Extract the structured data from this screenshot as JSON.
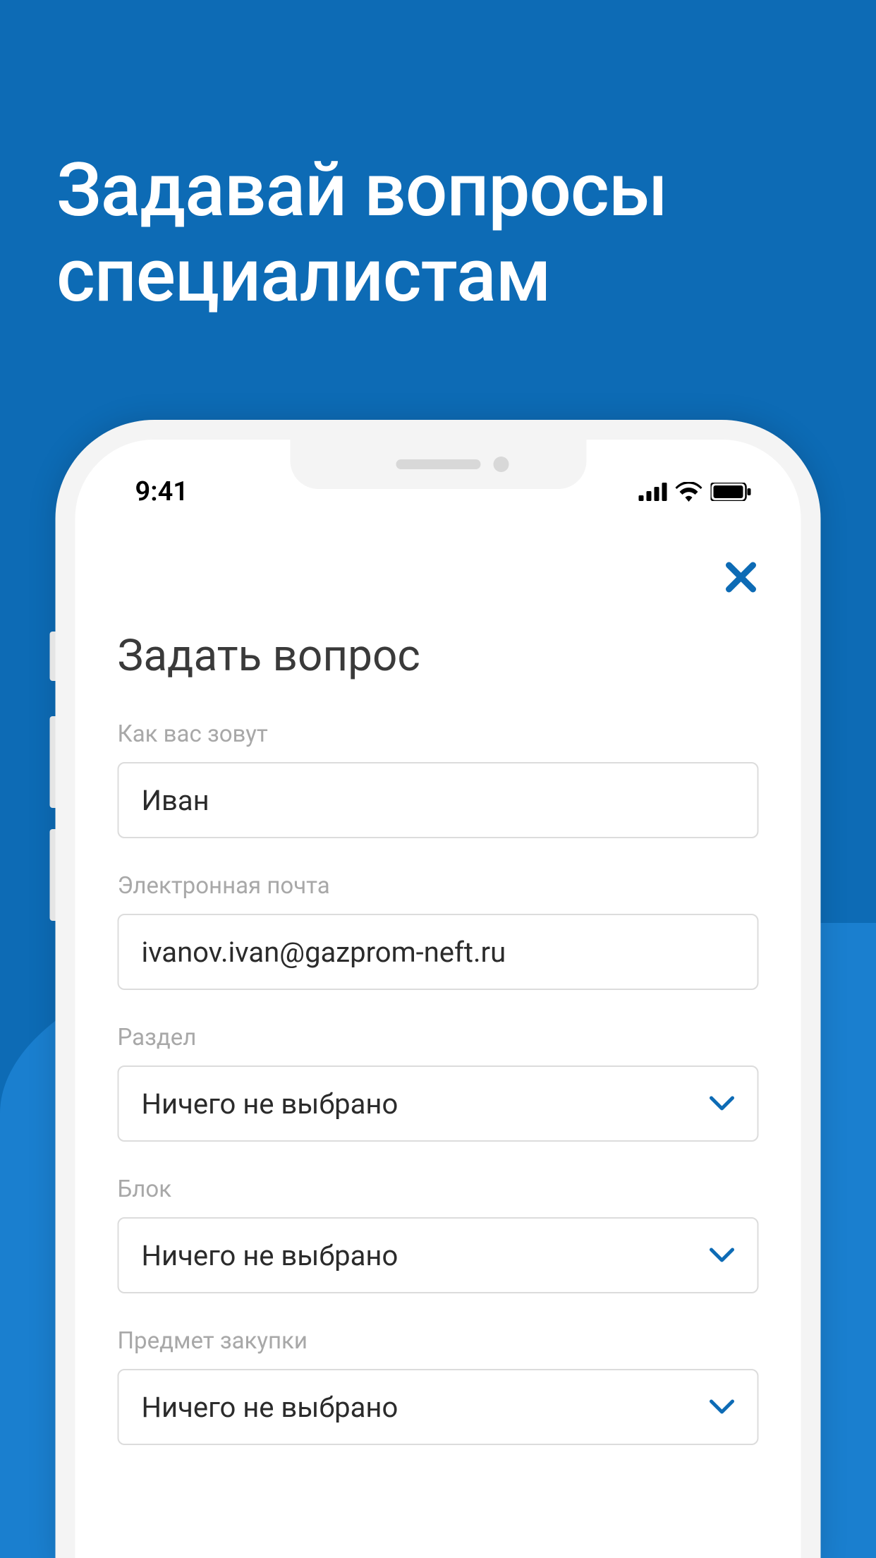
{
  "promo": {
    "line1": "Задавай вопросы",
    "line2": "специалистам"
  },
  "status": {
    "time": "9:41"
  },
  "form": {
    "title": "Задать вопрос",
    "name": {
      "label": "Как вас зовут",
      "value": "Иван"
    },
    "email": {
      "label": "Электронная почта",
      "value": "ivanov.ivan@gazprom-neft.ru"
    },
    "section": {
      "label": "Раздел",
      "value": "Ничего не выбрано"
    },
    "block": {
      "label": "Блок",
      "value": "Ничего не выбрано"
    },
    "subject": {
      "label": "Предмет закупки",
      "value": "Ничего не выбрано"
    }
  },
  "colors": {
    "accent": "#0d6bb5"
  }
}
